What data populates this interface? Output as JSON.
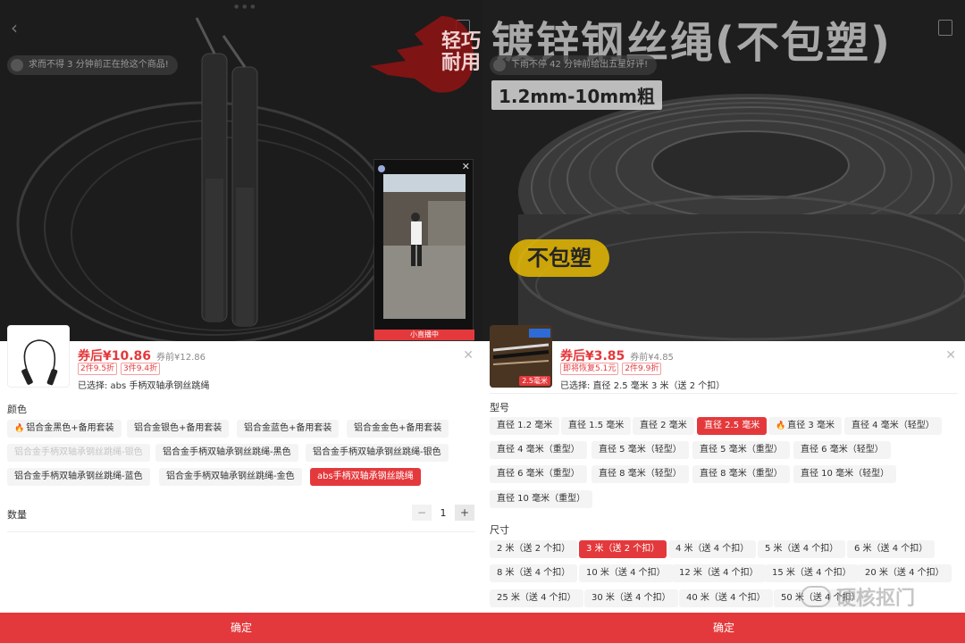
{
  "left": {
    "hero": {
      "badge_text": "轻巧耐用",
      "notice": "求而不得 3 分钟前正在抢这个商品!"
    },
    "live": {
      "header": "",
      "bar": "小直播中"
    },
    "thumb_tag": "",
    "price": "券后¥10.86",
    "original_price": "券前¥12.86",
    "promos": [
      "2件9.5折",
      "3件9.4折"
    ],
    "selected": "已选择: abs 手柄双轴承钢丝跳绳",
    "color_label": "颜色",
    "colors": [
      {
        "label": "铝合金黑色+备用套装",
        "state": "hot"
      },
      {
        "label": "铝合金银色+备用套装",
        "state": "normal"
      },
      {
        "label": "铝合金蓝色+备用套装",
        "state": "normal"
      },
      {
        "label": "铝合金金色+备用套装",
        "state": "normal"
      },
      {
        "label": "铝合金手柄双轴承钢丝跳绳-银色",
        "state": "disabled"
      },
      {
        "label": "铝合金手柄双轴承钢丝跳绳-黑色",
        "state": "normal"
      },
      {
        "label": "铝合金手柄双轴承钢丝跳绳-银色",
        "state": "normal"
      },
      {
        "label": "铝合金手柄双轴承钢丝跳绳-蓝色",
        "state": "normal"
      },
      {
        "label": "铝合金手柄双轴承钢丝跳绳-金色",
        "state": "normal"
      },
      {
        "label": "abs手柄双轴承钢丝跳绳",
        "state": "selected"
      }
    ],
    "qty_label": "数量",
    "qty_minus": "−",
    "qty_value": "1",
    "qty_plus": "+",
    "confirm": "确定"
  },
  "right": {
    "hero": {
      "big_title": "镀锌钢丝绳(不包塑)",
      "size_range": "1.2mm-10mm粗",
      "no_pack": "不包塑",
      "notice": "下雨不停 42 分钟前给出五星好评!"
    },
    "thumb_tag": "2.5毫米",
    "price": "券后¥3.85",
    "original_price": "券前¥4.85",
    "promos": [
      "即将恢复5.1元",
      "2件9.9折"
    ],
    "selected": "已选择: 直径 2.5 毫米 3 米（送 2 个扣）",
    "model_label": "型号",
    "models": [
      {
        "label": "直径 1.2 毫米",
        "state": "normal"
      },
      {
        "label": "直径 1.5 毫米",
        "state": "normal"
      },
      {
        "label": "直径 2 毫米",
        "state": "normal"
      },
      {
        "label": "直径 2.5 毫米",
        "state": "selected"
      },
      {
        "label": "直径 3 毫米",
        "state": "hot"
      },
      {
        "label": "直径 4 毫米（轻型）",
        "state": "normal"
      },
      {
        "label": "直径 4 毫米（重型）",
        "state": "normal"
      },
      {
        "label": "直径 5 毫米（轻型）",
        "state": "normal"
      },
      {
        "label": "直径 5 毫米（重型）",
        "state": "normal"
      },
      {
        "label": "直径 6 毫米（轻型）",
        "state": "normal"
      },
      {
        "label": "直径 6 毫米（重型）",
        "state": "normal"
      },
      {
        "label": "直径 8 毫米（轻型）",
        "state": "normal"
      },
      {
        "label": "直径 8 毫米（重型）",
        "state": "normal"
      },
      {
        "label": "直径 10 毫米（轻型）",
        "state": "normal"
      },
      {
        "label": "直径 10 毫米（重型）",
        "state": "normal"
      }
    ],
    "size_label": "尺寸",
    "sizes": [
      {
        "label": "2 米（送 2 个扣）",
        "state": "normal"
      },
      {
        "label": "3 米（送 2 个扣）",
        "state": "selected"
      },
      {
        "label": "4 米（送 4 个扣）",
        "state": "normal"
      },
      {
        "label": "5 米（送 4 个扣）",
        "state": "normal"
      },
      {
        "label": "6 米（送 4 个扣）",
        "state": "normal"
      },
      {
        "label": "8 米（送 4 个扣）",
        "state": "normal"
      },
      {
        "label": "10 米（送 4 个扣）",
        "state": "normal"
      },
      {
        "label": "12 米（送 4 个扣）",
        "state": "normal"
      },
      {
        "label": "15 米（送 4 个扣）",
        "state": "normal"
      },
      {
        "label": "20 米（送 4 个扣）",
        "state": "normal"
      },
      {
        "label": "25 米（送 4 个扣）",
        "state": "normal"
      },
      {
        "label": "30 米（送 4 个扣）",
        "state": "normal"
      },
      {
        "label": "40 米（送 4 个扣）",
        "state": "normal"
      },
      {
        "label": "50 米（送 4 个扣）",
        "state": "normal"
      }
    ],
    "confirm": "确定"
  },
  "watermark": "硬核抠门",
  "colors": {
    "accent": "#e4393c",
    "chip_bg": "#f4f4f4",
    "hero_bg": "#1b1b1b"
  }
}
